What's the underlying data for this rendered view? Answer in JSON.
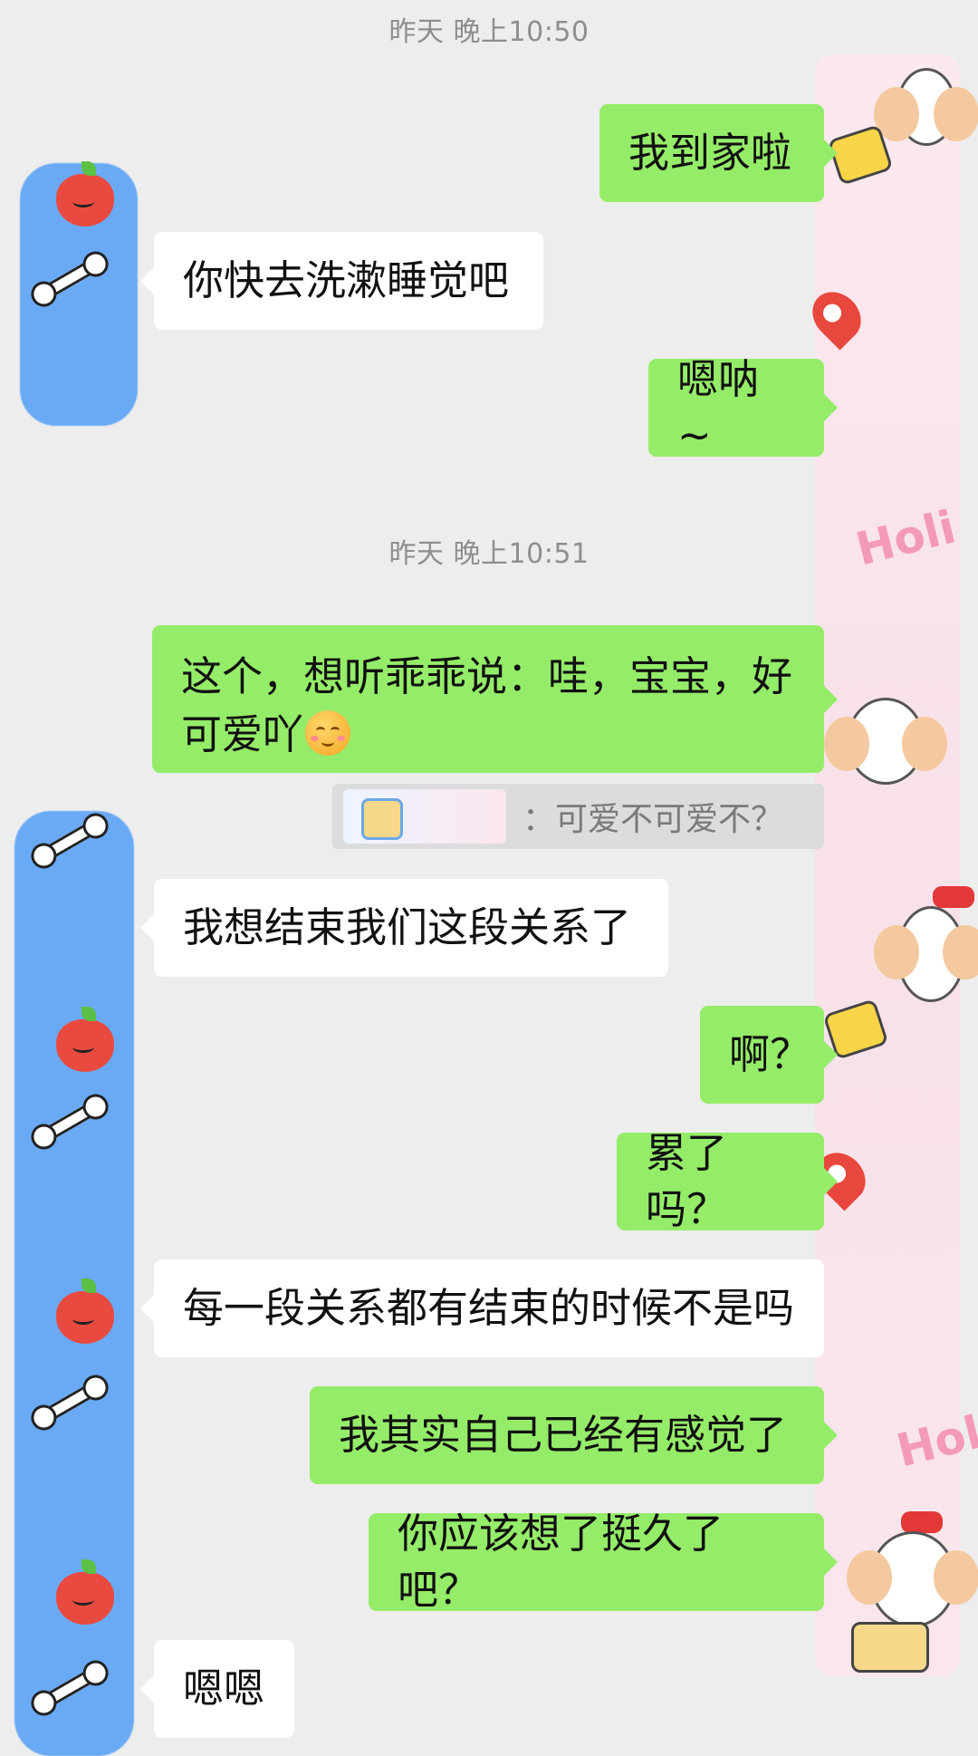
{
  "timestamps": [
    "昨天 晚上10:50",
    "昨天 晚上10:51"
  ],
  "messages": [
    {
      "side": "out",
      "text": "我到家啦"
    },
    {
      "side": "in",
      "text": "你快去洗漱睡觉吧"
    },
    {
      "side": "out",
      "text": "嗯呐 ~"
    },
    {
      "side": "out",
      "text": "这个，想听乖乖说：哇，宝宝，好",
      "text2": "可爱吖"
    },
    {
      "side": "in",
      "text": "我想结束我们这段关系了"
    },
    {
      "side": "out",
      "text": "啊？"
    },
    {
      "side": "out",
      "text": "累了吗？"
    },
    {
      "side": "in",
      "text": "每一段关系都有结束的时候不是吗"
    },
    {
      "side": "out",
      "text": "我其实自己已经有感觉了"
    },
    {
      "side": "out",
      "text": "你应该想了挺久了吧？"
    },
    {
      "side": "in",
      "text": "嗯嗯"
    }
  ],
  "quote": {
    "text": "：可爱不可爱不？"
  },
  "stickers": {
    "holi": "Holi"
  },
  "colors": {
    "background": "#ededed",
    "outgoing": "#95ec69",
    "incoming": "#ffffff",
    "timestamp": "#8e8e8e"
  },
  "icons": [
    "apple-icon",
    "bone-icon",
    "map-pin-icon",
    "dog-sticker",
    "suitcase-icon",
    "smiling-emoji-icon"
  ]
}
